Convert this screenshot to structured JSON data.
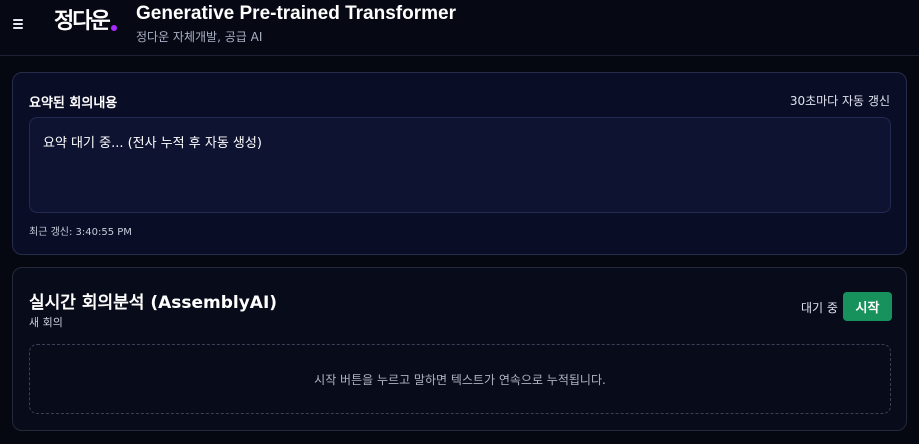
{
  "header": {
    "logo_text": "정다운",
    "title": "Generative Pre-trained Transformer",
    "subtitle": "정다운 자체개발, 공급 AI",
    "accent_color": "#a72bff"
  },
  "summary": {
    "title": "요약된 회의내용",
    "refresh_text": "30초마다 자동 갱신",
    "content": "요약 대기 중... (전사 누적 후 자동 생성)",
    "last_updated": "최근 갱신: 3:40:55 PM"
  },
  "live": {
    "title": "실시간 회의분석 (AssemblyAI)",
    "subtitle": "새 회의",
    "status": "대기 중",
    "start_label": "시작",
    "start_color": "#17925c",
    "hint": "시작 버튼을 누르고 말하면 텍스트가 연속으로 누적됩니다."
  }
}
